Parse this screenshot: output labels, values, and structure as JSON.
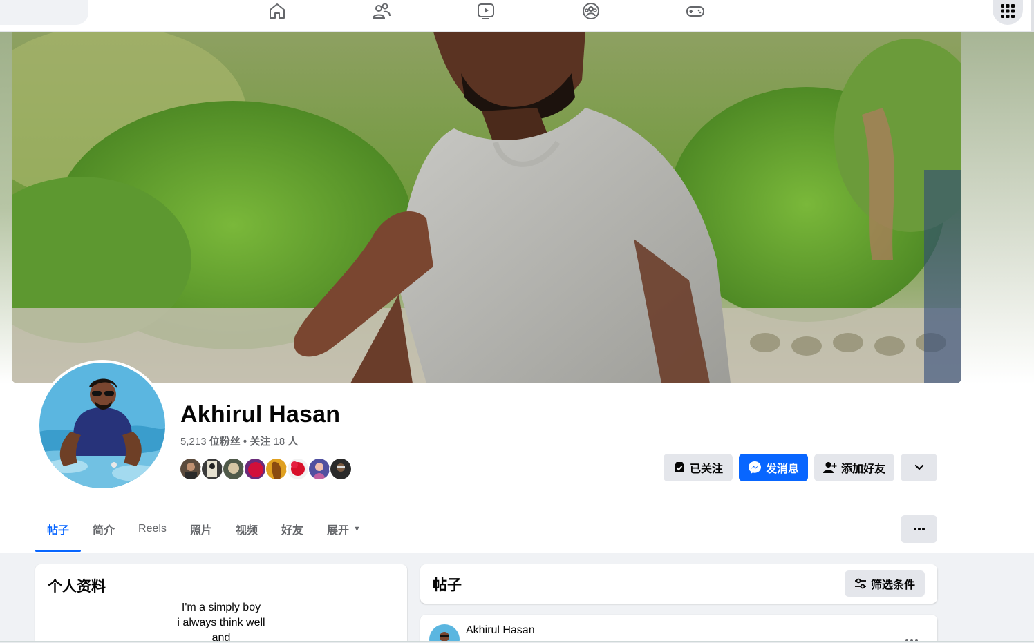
{
  "profile": {
    "name": "Akhirul Hasan",
    "followers_count": "5,213",
    "followers_label": "位粉丝",
    "separator": "•",
    "following_label": "关注",
    "following_count": "18",
    "following_unit": "人"
  },
  "actions": {
    "following": "已关注",
    "message": "发消息",
    "add_friend": "添加好友"
  },
  "tabs": [
    {
      "label": "帖子",
      "active": true
    },
    {
      "label": "简介"
    },
    {
      "label": "Reels"
    },
    {
      "label": "照片"
    },
    {
      "label": "视频"
    },
    {
      "label": "好友"
    },
    {
      "label": "展开"
    }
  ],
  "intro": {
    "title": "个人资料",
    "bio_lines": [
      "I'm a simply boy",
      "i always think well",
      "and"
    ]
  },
  "posts": {
    "title": "帖子",
    "filter_label": "筛选条件",
    "first_post_author": "Akhirul Hasan"
  },
  "icons": {
    "nav": [
      "home-icon",
      "friends-icon",
      "video-icon",
      "groups-icon",
      "gaming-icon"
    ],
    "apps": "grid-menu-icon",
    "message": "messenger-icon",
    "add_friend": "add-friend-icon",
    "more": "more-dots-icon",
    "filter": "sliders-icon",
    "dropdown": "chevron-down-icon"
  },
  "colors": {
    "accent": "#0866ff",
    "secondary_text": "#65676b",
    "button_grey": "#e4e6eb"
  }
}
